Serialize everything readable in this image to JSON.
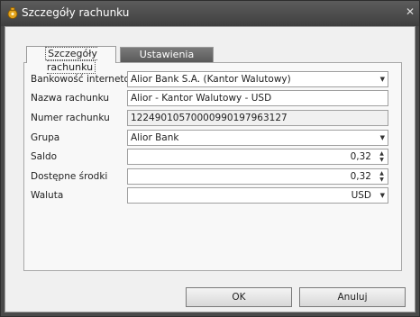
{
  "window": {
    "title": "Szczegóły rachunku"
  },
  "tabs": [
    {
      "label": "Szczegóły rachunku"
    },
    {
      "label": "Ustawienia rachunku"
    }
  ],
  "fields": {
    "bank": {
      "label": "Bankowość internetowa",
      "value": "Alior Bank S.A. (Kantor Walutowy)"
    },
    "account_name": {
      "label": "Nazwa rachunku",
      "value": "Alior - Kantor Walutowy - USD"
    },
    "account_number": {
      "label": "Numer rachunku",
      "value": "12249010570000990197963127"
    },
    "group": {
      "label": "Grupa",
      "value": "Alior Bank"
    },
    "balance": {
      "label": "Saldo",
      "value": "0,32"
    },
    "available": {
      "label": "Dostępne środki",
      "value": "0,32"
    },
    "currency": {
      "label": "Waluta",
      "value": "USD"
    }
  },
  "buttons": {
    "ok": "OK",
    "cancel": "Anuluj"
  },
  "icons": {
    "app": "moneybag-icon",
    "close": "close-icon",
    "dropdown": "chevron-down-icon",
    "spin": "spin-arrows-icon"
  }
}
